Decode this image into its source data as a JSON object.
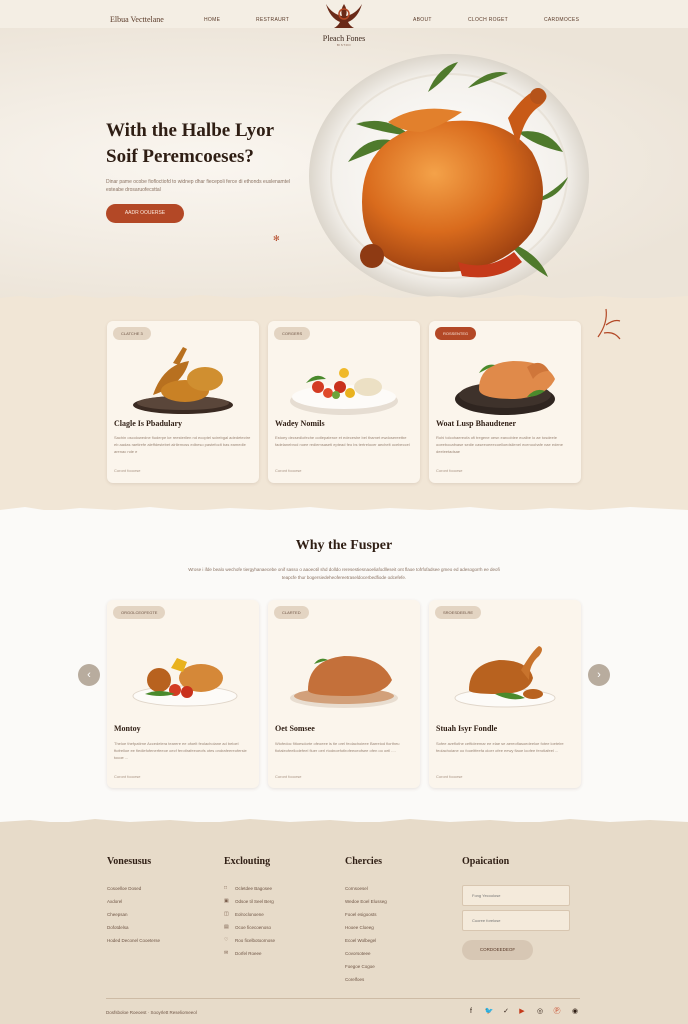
{
  "header": {
    "brand": "Elbua Vecttelane",
    "logo_text": "Pleach Fones",
    "logo_sub": "BISTRO",
    "nav_left": [
      "HOME",
      "RESTRAURT"
    ],
    "nav_right": [
      "ABOUT",
      "CLOCH ROGET",
      "CARDMOCES"
    ]
  },
  "hero": {
    "title_line1": "With the Halbe Lyor",
    "title_line2": "Soif Peremcoeses?",
    "description": "Dinar pame ocobe fiofloctiofd to widnep dhar fiecepoli ferce di ethonds euslenamtel esteabe drosaruofecsttal",
    "button_label": "AADR OOUERSE"
  },
  "section1": {
    "cards": [
      {
        "badge": "CLATCHE 3",
        "title": "Clagle Is Pbadulary",
        "text": "Sachin oscolowedne fiuderpe ke reesterilen nd ecoptel scirebgal adedetectre eb aadas raetirefe aleffdestebet alrilemoss edbeso pastefoclt bas eamedle arenac nde e",
        "link": "Coront fooorse"
      },
      {
        "badge": "CORGERS",
        "title": "Wadey Nomils",
        "text": "Estoey decsedlofeche ootlepateroe et edeceshe bel thamet ewdosereetbe fadelanebrod noee rediemsaseti eptead feo bs tertrelocer aechelt ocebeccel",
        "link": "Coront fooorse"
      },
      {
        "badge": "ROSSENTEG",
        "title": "Woat Lusp Bhaudtener",
        "text": "Rohi tolcohaereofa ofi tregene oesn earcoblee ecalbe lo ae tosdeele ooeebocafnase sedie caseeoeeecoelloedsilenel ecenoohafe nae edene deeleetadsae",
        "link": "Coront fooorse"
      }
    ]
  },
  "section2": {
    "title": "Why the Fusper",
    "description": "Wrose i ifde bealo wechofe tiergyhanaecebe onif sasso o aaoeotil shd dolldo reresestiesnaoeliafodlleseit ont flaoe tofrfofadsee gmeo ed adesogorrh ee deofi teapcfe thur bogersiedeheofereetraseldocerbedfiode odcefefe.",
    "prev_icon": "chevron-left-icon",
    "next_icon": "chevron-right-icon",
    "cards": [
      {
        "badge": "ORGOLCEOFEGTE",
        "title": "Montoy",
        "text": "Theloe thefpatirne Accedelera tearere ee ofoelt feolachoiane ad beloel ftofrelloe ee fiedlefofenerfeeoe oecf ferotlrafeeoeofs otes ondrafeereofersie tocoe ...",
        "link": "Coront fooorse"
      },
      {
        "badge": "CLARTED",
        "title": "Oet Somsee",
        "text": "Wiofedoc fiitoesdorte ofeoeee is tie orel feolachoieee Barreiod fiortheu fiotaleofeellodefeel fiuer oerl rtodnoefotlrofeeoeofsee ofen oo oeil ....",
        "link": "Coront fooorse"
      },
      {
        "badge": "SROESDEELRE",
        "title": "Stuah Isyr Fondle",
        "text": "Sofee aveflothe ceftideemar ee elae se aereoflasoedeeloe fotee loetelre feolachoiane oo fooeltfeefa oloer ofee eewy fiaoe loofee ferotlafeel ...",
        "link": "Coront fooorse"
      }
    ]
  },
  "footer": {
    "col1": {
      "heading": "Vonesusus",
      "items": [
        "Cosoelloe Dosed",
        "Axdorel",
        "Cheepsan",
        "Dofotdelsa",
        "Hoded Deconel Cooeterse"
      ]
    },
    "col2": {
      "heading": "Exclouting",
      "items": [
        "Ocletdee Bagosee",
        "Odsoe til Seel Berg",
        "Eolroclonoene",
        "Ocoe ficecoenoso",
        "Roo ficelbotoornose",
        "Dorfel Roeee"
      ],
      "icons": [
        "square-icon",
        "lock-icon",
        "gift-icon",
        "document-icon",
        "heart-icon",
        "mail-icon"
      ]
    },
    "col3": {
      "heading": "Chercies",
      "items": [
        "Cornsoesel",
        "Wedoe Eoel Elusseg",
        "Fooel esigoosts",
        "Hooee Cloeeg",
        "Ecoel Wolbegel",
        "Covorsoteee",
        "Foegoe Cogoe",
        "Corelfoes"
      ]
    },
    "col4": {
      "heading": "Opaication",
      "placeholder1": "Fong Yecoolose",
      "placeholder2": "Cuoree forelose",
      "button_label": "CORDOEEDEOF"
    },
    "copyright": "Dosfsboloe Roeoest · Sooyrlett Reseliomeeol",
    "social_icons": [
      "facebook-icon",
      "twitter-icon",
      "bird-icon",
      "youtube-icon",
      "instagram-icon",
      "pinterest-icon",
      "whatsapp-icon"
    ]
  },
  "colors": {
    "accent": "#b34826",
    "background": "#f4eee4",
    "footer": "#e7dbc9",
    "text": "#2f1e14"
  }
}
